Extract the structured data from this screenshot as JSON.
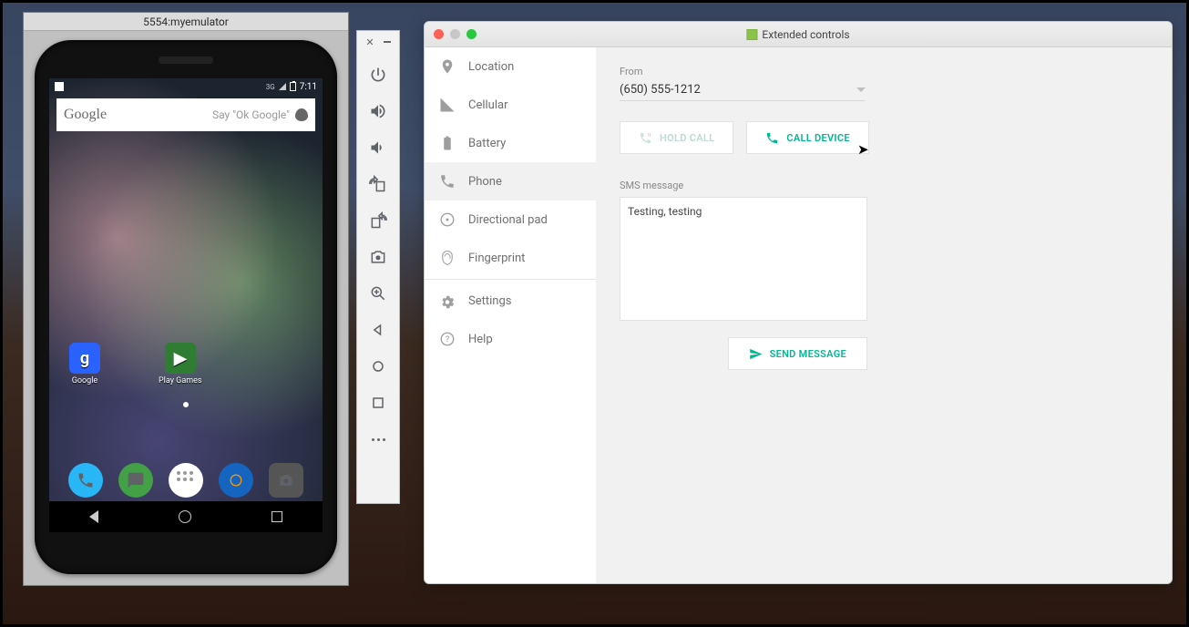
{
  "emulator": {
    "window_title": "5554:myemulator",
    "status_time": "7:11",
    "status_net": "3G",
    "search_brand": "Google",
    "search_hint": "Say \"Ok Google\"",
    "apps": [
      {
        "label": "Google"
      },
      {
        "label": "Play Games"
      }
    ]
  },
  "extended": {
    "window_title": "Extended controls",
    "sidebar": [
      {
        "label": "Location",
        "icon": "pin-icon",
        "selected": false
      },
      {
        "label": "Cellular",
        "icon": "signal-icon",
        "selected": false
      },
      {
        "label": "Battery",
        "icon": "battery-icon",
        "selected": false
      },
      {
        "label": "Phone",
        "icon": "phone-icon",
        "selected": true
      },
      {
        "label": "Directional pad",
        "icon": "dpad-icon",
        "selected": false
      },
      {
        "label": "Fingerprint",
        "icon": "fingerprint-icon",
        "selected": false
      },
      {
        "label": "Settings",
        "icon": "gear-icon",
        "selected": false
      },
      {
        "label": "Help",
        "icon": "help-icon",
        "selected": false
      }
    ],
    "phone_panel": {
      "from_label": "From",
      "from_value": "(650) 555-1212",
      "hold_call_label": "HOLD CALL",
      "call_device_label": "CALL DEVICE",
      "sms_label": "SMS message",
      "sms_value": "Testing, testing",
      "send_label": "SEND MESSAGE"
    }
  }
}
